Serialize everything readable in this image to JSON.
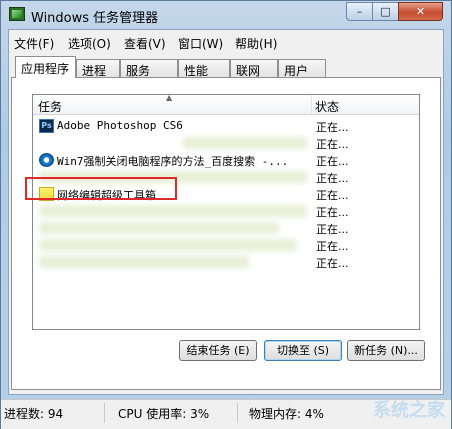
{
  "window": {
    "title": "Windows 任务管理器",
    "min_glyph": "–",
    "max_glyph": "□",
    "close_glyph": "✕"
  },
  "menu": [
    "文件(F)",
    "选项(O)",
    "查看(V)",
    "窗口(W)",
    "帮助(H)"
  ],
  "tabs": [
    "应用程序",
    "进程",
    "服务",
    "性能",
    "联网",
    "用户"
  ],
  "list": {
    "headers": {
      "task": "任务",
      "status": "状态"
    },
    "rows": [
      {
        "name": "Adobe Photoshop CS6",
        "status": "正在...",
        "icon": "photoshop-icon"
      },
      {
        "name": "",
        "status": "正在..."
      },
      {
        "name": "Win7强制关闭电脑程序的方法_百度搜索 -...",
        "status": "正在...",
        "icon": "ie-icon"
      },
      {
        "name": "",
        "status": "正在..."
      },
      {
        "name": "网络编辑超级工具箱",
        "status": "正在...",
        "icon": "folder-icon"
      },
      {
        "name": "",
        "status": "正在..."
      },
      {
        "name": "",
        "status": "正在..."
      },
      {
        "name": "",
        "status": "正在..."
      },
      {
        "name": "",
        "status": "正在..."
      }
    ]
  },
  "buttons": {
    "end_task": "结束任务 (E)",
    "switch_to": "切换至 (S)",
    "new_task": "新任务 (N)..."
  },
  "statusbar": {
    "processes": "进程数: 94",
    "cpu": "CPU 使用率: 3%",
    "memory": "物理内存: 4%"
  },
  "watermark": "系统之家"
}
